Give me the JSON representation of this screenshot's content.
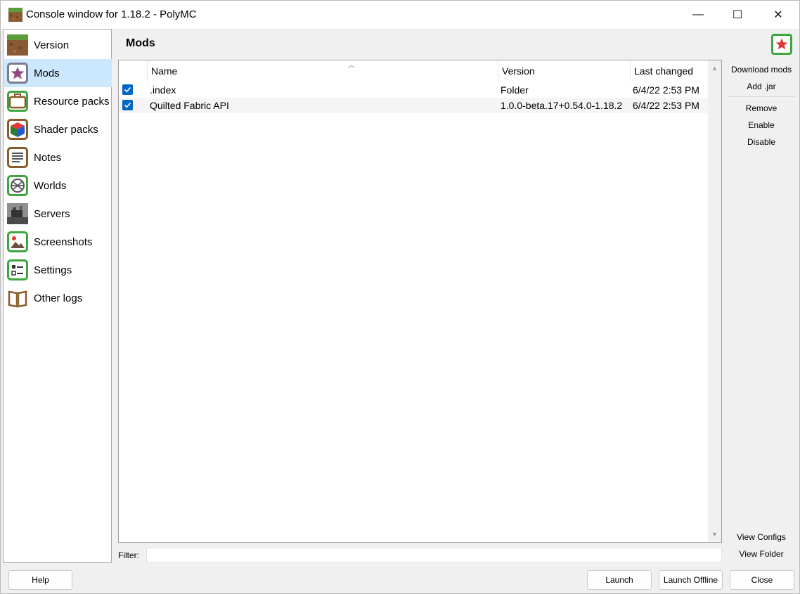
{
  "window": {
    "title": "Console window for 1.18.2 - PolyMC",
    "controls": {
      "minimize": "—",
      "maximize": "☐",
      "close": "✕"
    }
  },
  "sidebar": {
    "items": [
      {
        "label": "Version",
        "icon": "grass-block-icon"
      },
      {
        "label": "Mods",
        "icon": "star-icon",
        "selected": true
      },
      {
        "label": "Resource packs",
        "icon": "briefcase-icon"
      },
      {
        "label": "Shader packs",
        "icon": "cube-icon"
      },
      {
        "label": "Notes",
        "icon": "notes-icon"
      },
      {
        "label": "Worlds",
        "icon": "globe-icon"
      },
      {
        "label": "Servers",
        "icon": "server-icon"
      },
      {
        "label": "Screenshots",
        "icon": "picture-icon"
      },
      {
        "label": "Settings",
        "icon": "checklist-icon"
      },
      {
        "label": "Other logs",
        "icon": "book-icon"
      }
    ]
  },
  "page": {
    "title": "Mods"
  },
  "table": {
    "columns": [
      "Name",
      "Version",
      "Last changed"
    ],
    "rows": [
      {
        "checked": true,
        "name": ".index",
        "version": "Folder",
        "last_changed": "6/4/22 2:53 PM"
      },
      {
        "checked": true,
        "name": "Quilted Fabric API",
        "version": "1.0.0-beta.17+0.54.0-1.18.2",
        "last_changed": "6/4/22 2:53 PM"
      }
    ]
  },
  "actions": {
    "download_mods": "Download mods",
    "add_jar": "Add .jar",
    "remove": "Remove",
    "enable": "Enable",
    "disable": "Disable",
    "view_configs": "View Configs",
    "view_folder": "View Folder"
  },
  "filter": {
    "label": "Filter:",
    "value": ""
  },
  "footer": {
    "help": "Help",
    "launch": "Launch",
    "launch_offline": "Launch Offline",
    "close": "Close"
  },
  "colors": {
    "selection": "#cce8ff",
    "checkbox": "#0067c0",
    "accent_green": "#3ea63e",
    "accent_brown": "#8b5a2b",
    "star_red": "#d93a3a"
  }
}
